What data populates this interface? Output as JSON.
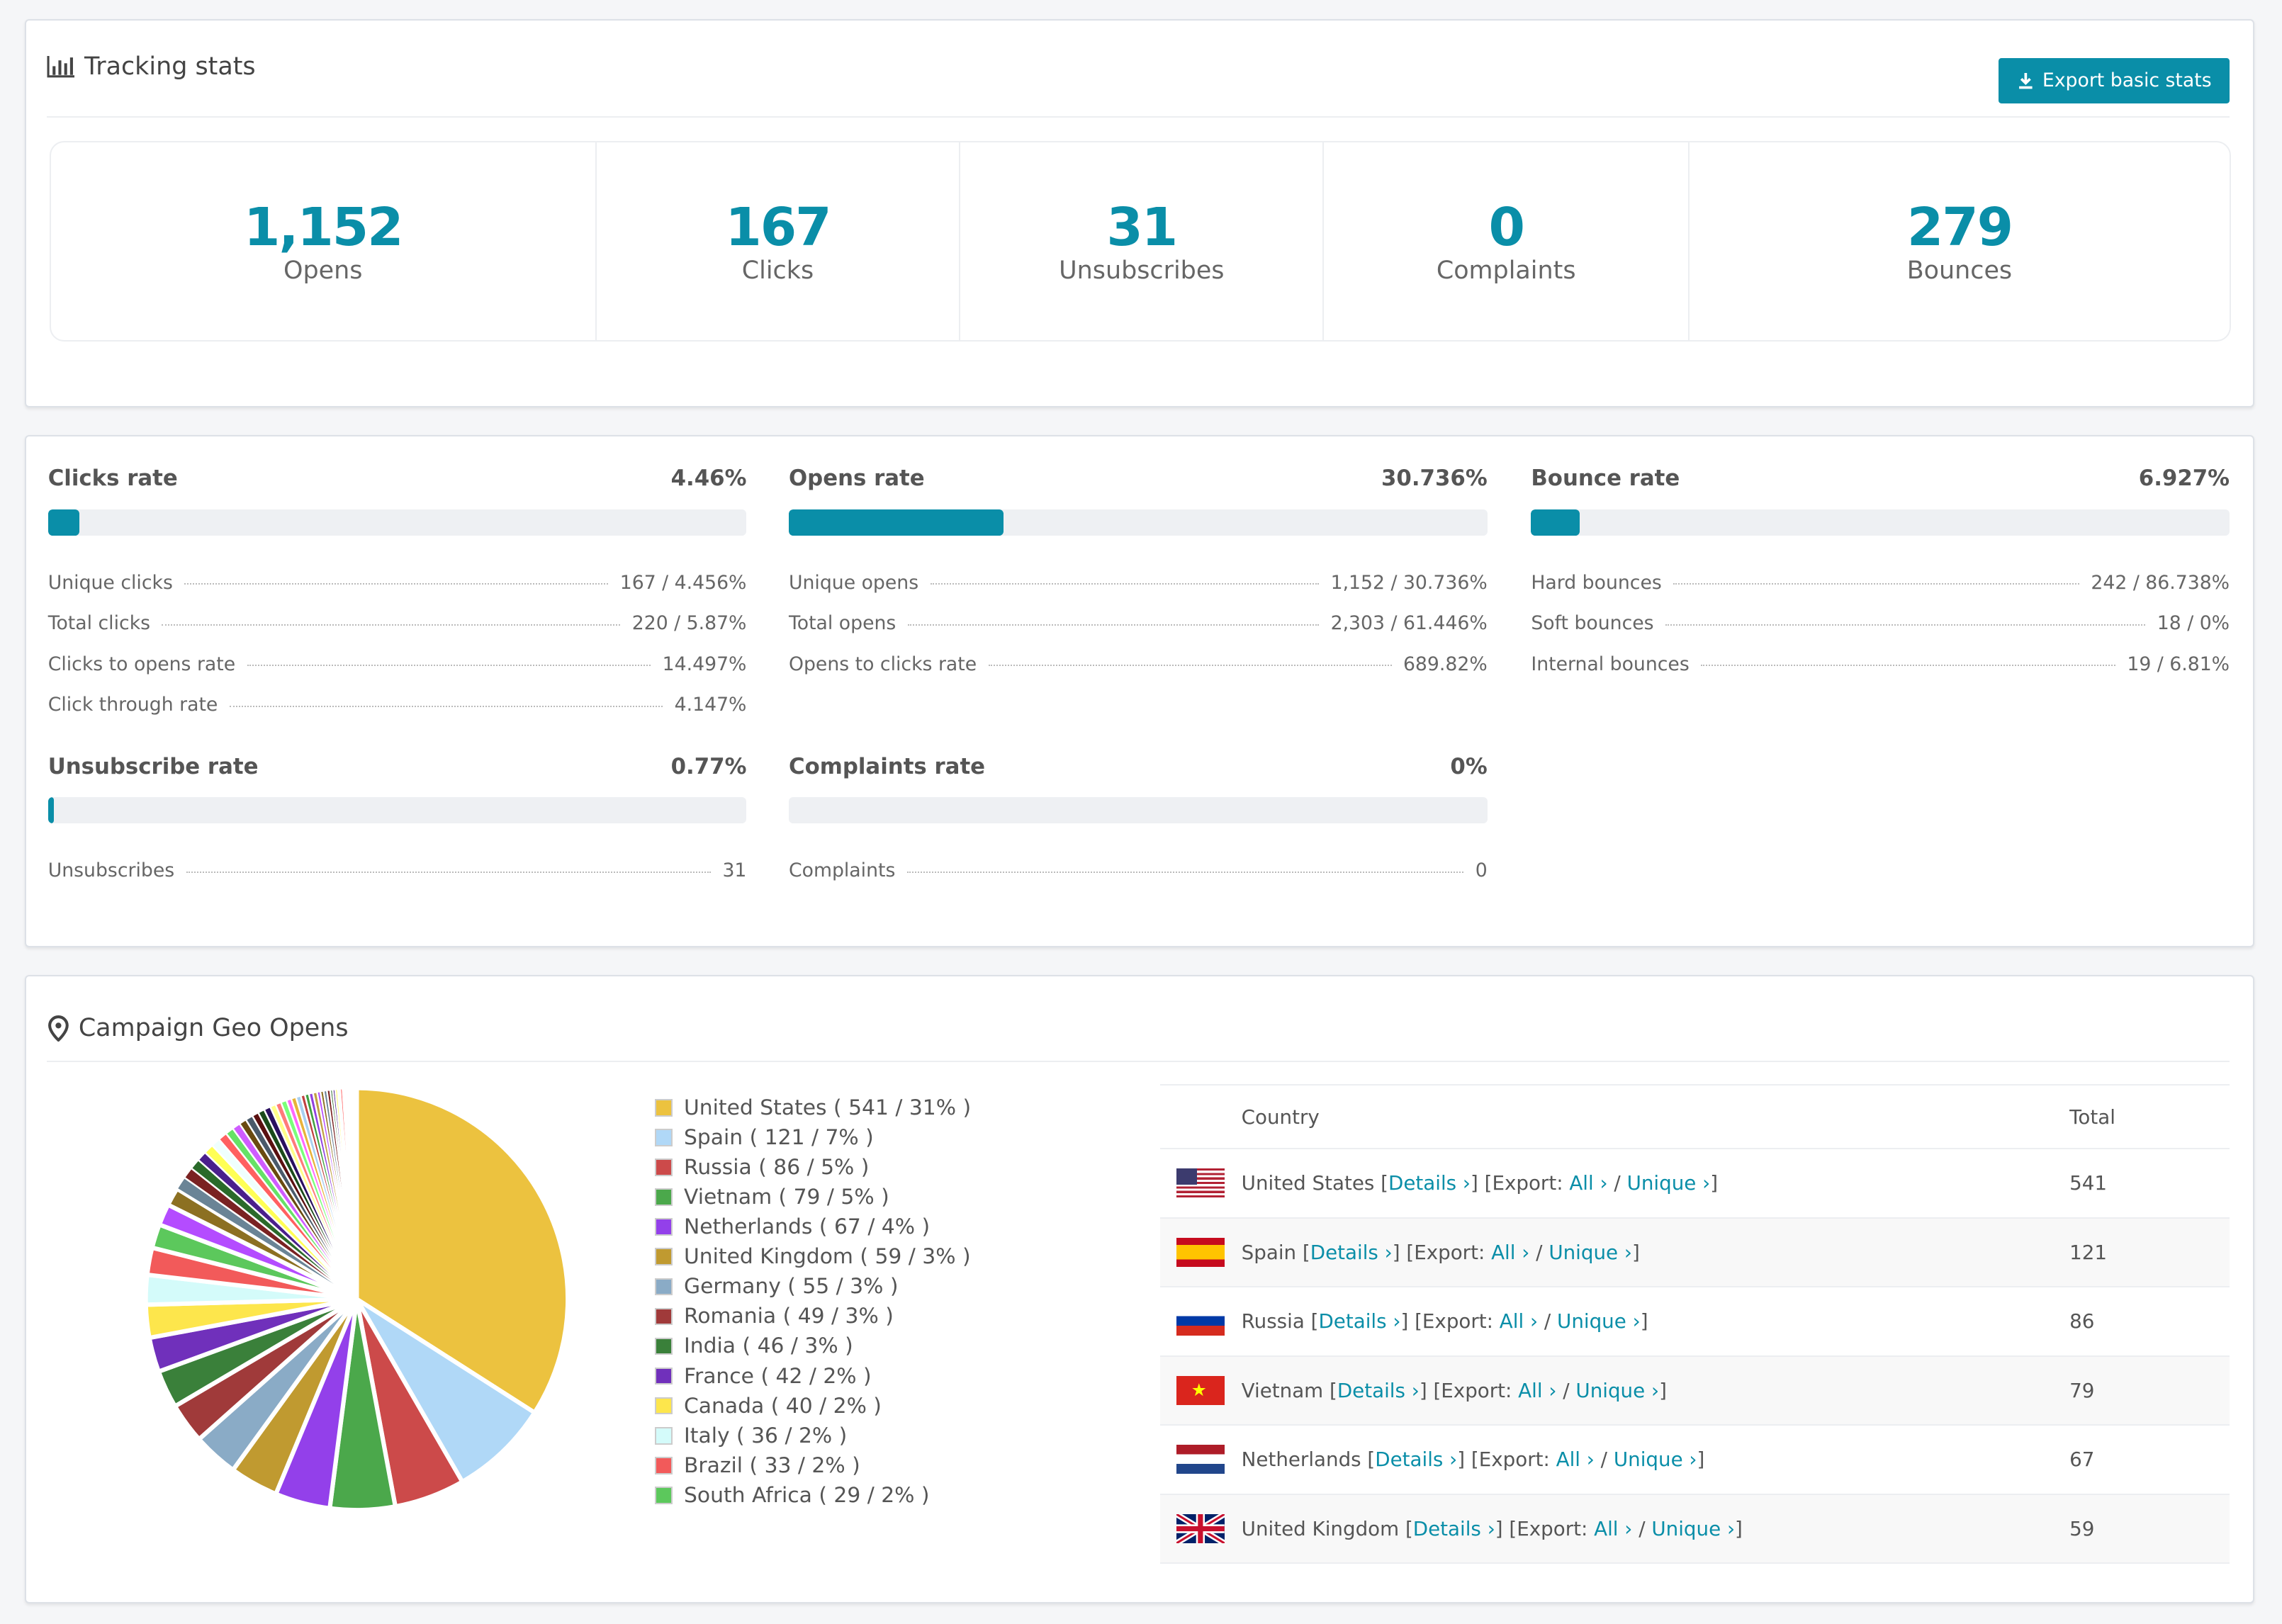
{
  "tracking": {
    "title": "Tracking stats",
    "export_label": "Export basic stats",
    "stats": [
      {
        "value": "1,152",
        "label": "Opens"
      },
      {
        "value": "167",
        "label": "Clicks"
      },
      {
        "value": "31",
        "label": "Unsubscribes"
      },
      {
        "value": "0",
        "label": "Complaints"
      },
      {
        "value": "279",
        "label": "Bounces"
      }
    ]
  },
  "rates": [
    {
      "title": "Clicks rate",
      "value": "4.46%",
      "percent": 4.46,
      "rows": [
        {
          "label": "Unique clicks",
          "value": "167 / 4.456%"
        },
        {
          "label": "Total clicks",
          "value": "220 / 5.87%"
        },
        {
          "label": "Clicks to opens rate",
          "value": "14.497%"
        },
        {
          "label": "Click through rate",
          "value": "4.147%"
        }
      ]
    },
    {
      "title": "Opens rate",
      "value": "30.736%",
      "percent": 30.736,
      "rows": [
        {
          "label": "Unique opens",
          "value": "1,152 / 30.736%"
        },
        {
          "label": "Total opens",
          "value": "2,303 / 61.446%"
        },
        {
          "label": "Opens to clicks rate",
          "value": "689.82%"
        }
      ]
    },
    {
      "title": "Bounce rate",
      "value": "6.927%",
      "percent": 6.927,
      "rows": [
        {
          "label": "Hard bounces",
          "value": "242 / 86.738%"
        },
        {
          "label": "Soft bounces",
          "value": "18 / 0%"
        },
        {
          "label": "Internal bounces",
          "value": "19 / 6.81%"
        }
      ]
    },
    {
      "title": "Unsubscribe rate",
      "value": "0.77%",
      "percent": 0.77,
      "rows": [
        {
          "label": "Unsubscribes",
          "value": "31"
        }
      ]
    },
    {
      "title": "Complaints rate",
      "value": "0%",
      "percent": 0,
      "rows": [
        {
          "label": "Complaints",
          "value": "0"
        }
      ]
    }
  ],
  "geo": {
    "title": "Campaign Geo Opens",
    "table": {
      "headers": [
        "Country",
        "Total"
      ],
      "details_label": "Details ›",
      "export_label": "[Export:",
      "all_label": "All ›",
      "unique_label": "Unique ›",
      "rows": [
        {
          "country": "United States",
          "flag": "us",
          "total": "541"
        },
        {
          "country": "Spain",
          "flag": "es",
          "total": "121"
        },
        {
          "country": "Russia",
          "flag": "ru",
          "total": "86"
        },
        {
          "country": "Vietnam",
          "flag": "vn",
          "total": "79"
        },
        {
          "country": "Netherlands",
          "flag": "nl",
          "total": "67"
        },
        {
          "country": "United Kingdom",
          "flag": "gb",
          "total": "59"
        }
      ]
    }
  },
  "chart_data": {
    "type": "pie",
    "legend_position": "right",
    "slices": [
      {
        "label": "United States ( 541 / 31% )",
        "value": 541,
        "color": "#ecc23f"
      },
      {
        "label": "Spain ( 121 / 7% )",
        "value": 121,
        "color": "#b0d8f7"
      },
      {
        "label": "Russia ( 86 / 5% )",
        "value": 86,
        "color": "#cc4a4a"
      },
      {
        "label": "Vietnam ( 79 / 5% )",
        "value": 79,
        "color": "#4ba84b"
      },
      {
        "label": "Netherlands ( 67 / 4% )",
        "value": 67,
        "color": "#9340ea"
      },
      {
        "label": "United Kingdom ( 59 / 3% )",
        "value": 59,
        "color": "#c09a30"
      },
      {
        "label": "Germany ( 55 / 3% )",
        "value": 55,
        "color": "#8aabc6"
      },
      {
        "label": "Romania ( 49 / 3% )",
        "value": 49,
        "color": "#a03a3a"
      },
      {
        "label": "India ( 46 / 3% )",
        "value": 46,
        "color": "#3a803a"
      },
      {
        "label": "France ( 42 / 2% )",
        "value": 42,
        "color": "#7030bb"
      },
      {
        "label": "Canada ( 40 / 2% )",
        "value": 40,
        "color": "#fde64c"
      },
      {
        "label": "Italy ( 36 / 2% )",
        "value": 36,
        "color": "#d4fbfa"
      },
      {
        "label": "Brazil ( 33 / 2% )",
        "value": 33,
        "color": "#f25a5a"
      },
      {
        "label": "South Africa ( 29 / 2% )",
        "value": 29,
        "color": "#5cc85c"
      }
    ],
    "unlabeled_slices": {
      "values": [
        26,
        22,
        16,
        14,
        13,
        12,
        12,
        11,
        11,
        10,
        10,
        9,
        9,
        8,
        8,
        8,
        7,
        7,
        7,
        6,
        6,
        6,
        5,
        5,
        5,
        5,
        4,
        4,
        4,
        4,
        3,
        3,
        3,
        3,
        3,
        2,
        2,
        2,
        2,
        2,
        2,
        1,
        1,
        1,
        1,
        1
      ],
      "colors": [
        "#b44cff",
        "#8c7022",
        "#6a8496",
        "#7a2222",
        "#2a6a2a",
        "#4a1f8c",
        "#ffff55",
        "#effffe",
        "#ff6060",
        "#66e266",
        "#cf5cff",
        "#6a4a10",
        "#4a5a6a",
        "#5a1010",
        "#1a4a1a",
        "#2a1060",
        "#ffff88",
        "#ff7a7a",
        "#7aff7a",
        "#ff66ff",
        "#e8b23a",
        "#a8d0f0",
        "#c04040",
        "#40a040",
        "#9040e0",
        "#c0a040"
      ]
    }
  }
}
